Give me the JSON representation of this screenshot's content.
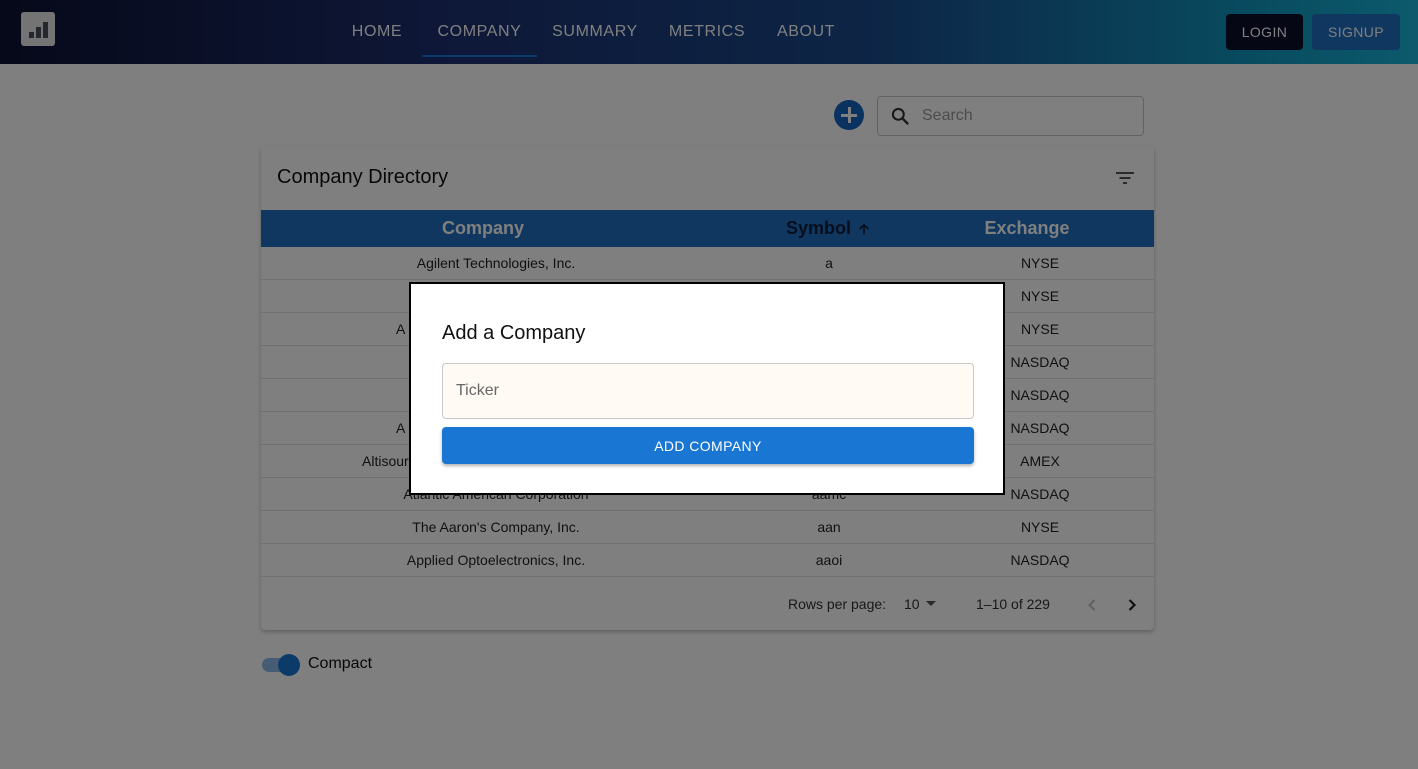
{
  "nav": {
    "items": [
      {
        "label": "HOME"
      },
      {
        "label": "COMPANY"
      },
      {
        "label": "SUMMARY"
      },
      {
        "label": "METRICS"
      },
      {
        "label": "ABOUT"
      }
    ],
    "active": "COMPANY",
    "login_label": "LOGIN",
    "signup_label": "SIGNUP"
  },
  "search": {
    "placeholder": "Search",
    "value": ""
  },
  "table": {
    "title": "Company Directory",
    "columns": [
      "Company",
      "Symbol",
      "Exchange"
    ],
    "sorted_column": "Symbol",
    "sort_direction": "ascending",
    "rows": [
      {
        "company": "Agilent Technologies, Inc.",
        "symbol": "a",
        "exchange": "NYSE"
      },
      {
        "company": "",
        "symbol": "",
        "exchange": "NYSE"
      },
      {
        "company": "A",
        "symbol": "",
        "exchange": "NYSE"
      },
      {
        "company": "",
        "symbol": "",
        "exchange": "NASDAQ"
      },
      {
        "company": "",
        "symbol": "",
        "exchange": "NASDAQ"
      },
      {
        "company": "A",
        "symbol": "",
        "exchange": "NASDAQ"
      },
      {
        "company": "Altisour",
        "symbol": "",
        "exchange": "AMEX"
      },
      {
        "company": "Atlantic American Corporation",
        "symbol": "aamc",
        "exchange": "NASDAQ"
      },
      {
        "company": "The Aaron's Company, Inc.",
        "symbol": "aan",
        "exchange": "NYSE"
      },
      {
        "company": "Applied Optoelectronics, Inc.",
        "symbol": "aaoi",
        "exchange": "NASDAQ"
      }
    ],
    "rows_per_page_label": "Rows per page:",
    "rows_per_page": "10",
    "range": "1–10 of 229"
  },
  "compact": {
    "label": "Compact",
    "enabled": true
  },
  "modal": {
    "title": "Add a Company",
    "ticker_placeholder": "Ticker",
    "ticker_value": "",
    "add_label": "ADD COMPANY"
  },
  "colors": {
    "primary": "#1976d2",
    "header_blue": "#1e6ebe",
    "overlay": "rgba(0,0,0,0.5)"
  }
}
